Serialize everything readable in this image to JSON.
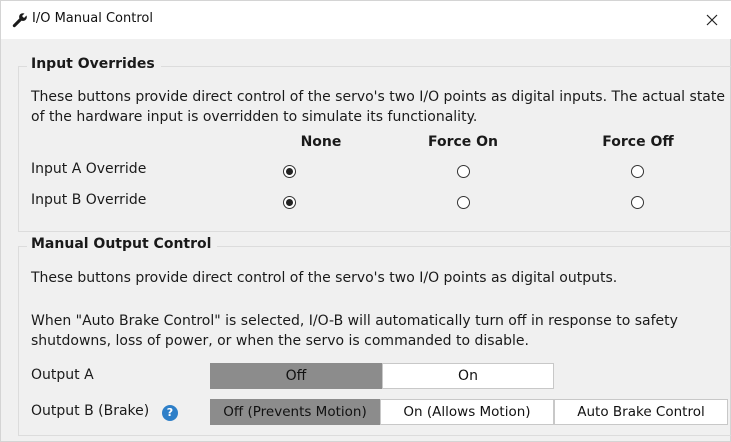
{
  "window": {
    "title": "I/O Manual Control",
    "close_label": "X",
    "title_icon": "wrench-icon"
  },
  "input_overrides": {
    "title": "Input Overrides",
    "description": "These buttons provide direct control of the servo's two I/O points as digital inputs. The actual state of the hardware input is overridden to simulate its functionality.",
    "columns": [
      "None",
      "Force On",
      "Force Off"
    ],
    "rows": [
      {
        "label": "Input A Override",
        "selected": "None"
      },
      {
        "label": "Input B Override",
        "selected": "None"
      }
    ]
  },
  "manual_output": {
    "title": "Manual Output Control",
    "description": "These buttons provide direct control of the servo's two I/O points as digital outputs.",
    "note": "When \"Auto Brake Control\" is selected, I/O-B will automatically turn off in response to safety shutdowns, loss of power, or when the servo is commanded to disable.",
    "output_a": {
      "label": "Output A",
      "options": [
        "Off",
        "On"
      ],
      "selected": "Off"
    },
    "output_b": {
      "label": "Output B (Brake)",
      "help_icon": "help-icon",
      "help_glyph": "?",
      "options": [
        "Off (Prevents Motion)",
        "On (Allows Motion)",
        "Auto Brake Control"
      ],
      "selected": "Off (Prevents Motion)"
    }
  },
  "colors": {
    "accent": "#2e7fc8",
    "selected_segment": "#8c8c8c",
    "background": "#f0f0f0"
  }
}
